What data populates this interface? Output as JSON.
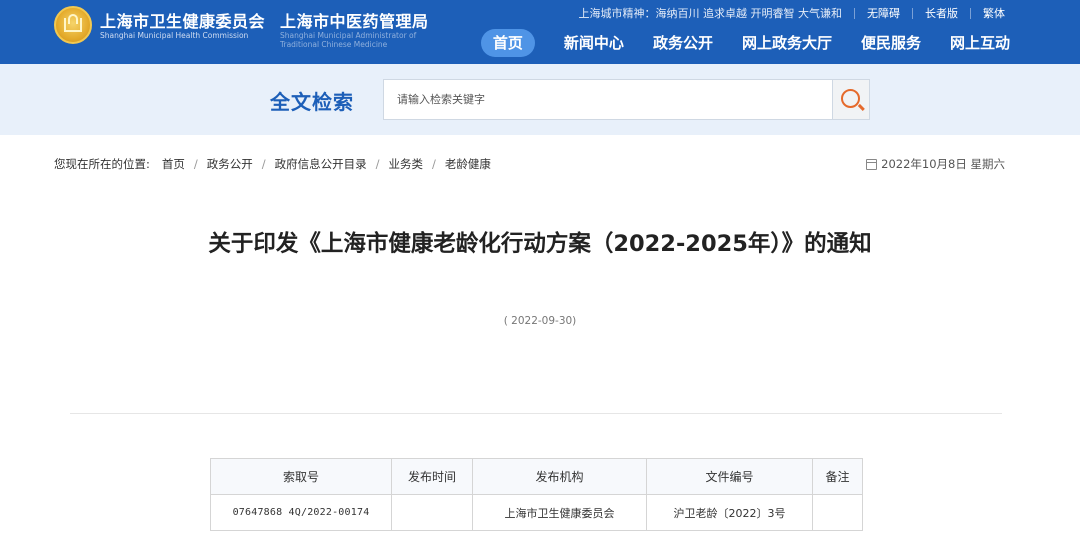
{
  "header": {
    "org1_name": "上海市卫生健康委员会",
    "org1_en": "Shanghai Municipal Health Commission",
    "org2_name": "上海市中医药管理局",
    "org2_en": "Shanghai Municipal Administrator of Traditional Chinese Medicine",
    "city_spirit": "上海城市精神：海纳百川 追求卓越 开明睿智 大气谦和",
    "accessibility": "无障碍",
    "elder_mode": "长者版",
    "traditional": "繁体",
    "nav": [
      "首页",
      "新闻中心",
      "政务公开",
      "网上政务大厅",
      "便民服务",
      "网上互动"
    ]
  },
  "search": {
    "title": "全文检索",
    "placeholder": "请输入检索关键字"
  },
  "breadcrumb": {
    "lead": "您现在所在的位置:",
    "items": [
      "首页",
      "政务公开",
      "政府信息公开目录",
      "业务类",
      "老龄健康"
    ]
  },
  "date_display": "2022年10月8日 星期六",
  "article": {
    "title": "关于印发《上海市健康老龄化行动方案（2022-2025年）》的通知",
    "date": "( 2022-09-30)"
  },
  "info_table": {
    "headers": [
      "索取号",
      "发布时间",
      "发布机构",
      "文件编号",
      "备注"
    ],
    "row": [
      "07647868 4Q/2022-00174",
      "",
      "上海市卫生健康委员会",
      "沪卫老龄〔2022〕3号",
      ""
    ]
  }
}
